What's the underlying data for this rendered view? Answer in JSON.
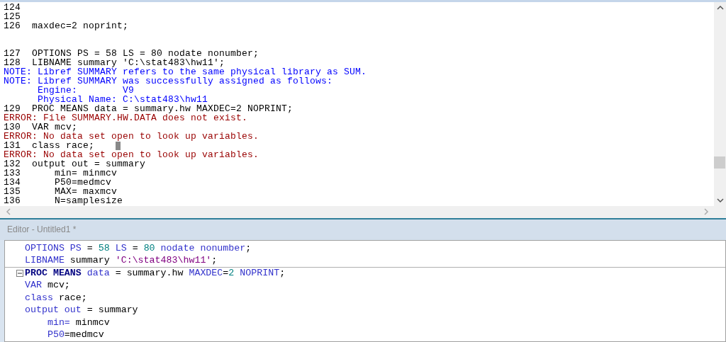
{
  "log": {
    "lines": [
      {
        "kind": "source",
        "number": "124"
      },
      {
        "kind": "source",
        "number": "125"
      },
      {
        "kind": "source",
        "number": "126",
        "text": "maxdec=2 noprint;"
      },
      {
        "kind": "blank"
      },
      {
        "kind": "blank"
      },
      {
        "kind": "source",
        "number": "127",
        "text": "OPTIONS PS = 58 LS = 80 nodate nonumber;"
      },
      {
        "kind": "source",
        "number": "128",
        "text": "LIBNAME summary 'C:\\stat483\\hw11';"
      },
      {
        "kind": "note",
        "text": "NOTE: Libref SUMMARY refers to the same physical library as SUM."
      },
      {
        "kind": "note",
        "text": "NOTE: Libref SUMMARY was successfully assigned as follows:"
      },
      {
        "kind": "note",
        "text": "      Engine:        V9"
      },
      {
        "kind": "note",
        "text": "      Physical Name: C:\\stat483\\hw11"
      },
      {
        "kind": "source",
        "number": "129",
        "text": "PROC MEANS data = summary.hw MAXDEC=2 NOPRINT;"
      },
      {
        "kind": "error",
        "text": "ERROR: File SUMMARY.HW.DATA does not exist."
      },
      {
        "kind": "source",
        "number": "130",
        "text": "VAR mcv;"
      },
      {
        "kind": "error",
        "text": "ERROR: No data set open to look up variables."
      },
      {
        "kind": "source",
        "number": "131",
        "text": "class race;",
        "cursor": true
      },
      {
        "kind": "error",
        "text": "ERROR: No data set open to look up variables."
      },
      {
        "kind": "source",
        "number": "132",
        "text": "output out = summary"
      },
      {
        "kind": "source",
        "number": "133",
        "text": "    min= minmcv"
      },
      {
        "kind": "source",
        "number": "134",
        "text": "    P50=medmcv"
      },
      {
        "kind": "source",
        "number": "135",
        "text": "    MAX= maxmcv"
      },
      {
        "kind": "source",
        "number": "136",
        "text": "    N=samplesize"
      }
    ]
  },
  "editor": {
    "title": "Editor - Untitled1 *",
    "lines": [
      {
        "tokens": [
          {
            "kind": "keyword",
            "text": "OPTIONS PS"
          },
          {
            "kind": "plain",
            "text": " = "
          },
          {
            "kind": "number",
            "text": "58"
          },
          {
            "kind": "keyword",
            "text": " LS"
          },
          {
            "kind": "plain",
            "text": " = "
          },
          {
            "kind": "number",
            "text": "80"
          },
          {
            "kind": "keyword",
            "text": " nodate nonumber"
          },
          {
            "kind": "plain",
            "text": ";"
          }
        ]
      },
      {
        "tokens": [
          {
            "kind": "keyword",
            "text": "LIBNAME"
          },
          {
            "kind": "plain",
            "text": " summary "
          },
          {
            "kind": "string",
            "text": "'C:\\stat483\\hw11'"
          },
          {
            "kind": "plain",
            "text": ";"
          }
        ]
      },
      {
        "fold": true,
        "tokens": [
          {
            "kind": "step",
            "text": "PROC MEANS"
          },
          {
            "kind": "keyword",
            "text": " data"
          },
          {
            "kind": "plain",
            "text": " = summary.hw "
          },
          {
            "kind": "keyword",
            "text": "MAXDEC"
          },
          {
            "kind": "plain",
            "text": "="
          },
          {
            "kind": "number",
            "text": "2"
          },
          {
            "kind": "keyword",
            "text": " NOPRINT"
          },
          {
            "kind": "plain",
            "text": ";"
          }
        ]
      },
      {
        "tokens": [
          {
            "kind": "keyword",
            "text": "VAR"
          },
          {
            "kind": "plain",
            "text": " mcv;"
          }
        ]
      },
      {
        "tokens": [
          {
            "kind": "keyword",
            "text": "class"
          },
          {
            "kind": "plain",
            "text": " race;"
          }
        ]
      },
      {
        "tokens": [
          {
            "kind": "keyword",
            "text": "output out"
          },
          {
            "kind": "plain",
            "text": " = summary"
          }
        ]
      },
      {
        "tokens": [
          {
            "kind": "keyword",
            "text": "    min="
          },
          {
            "kind": "plain",
            "text": " minmcv"
          }
        ]
      },
      {
        "tokens": [
          {
            "kind": "keyword",
            "text": "    P50"
          },
          {
            "kind": "plain",
            "text": "=medmcv"
          }
        ]
      }
    ]
  }
}
